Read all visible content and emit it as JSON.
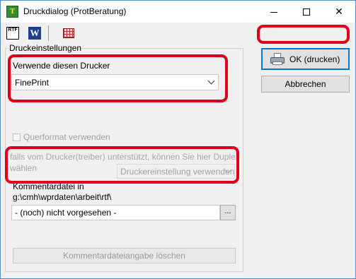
{
  "window": {
    "title": "Druckdialog (ProtBeratung)",
    "title_icon_glyph": "T",
    "close_glyph": "✕"
  },
  "toolbar": {
    "rtf_icon_text": "RTF",
    "word_icon_text": "W"
  },
  "group": {
    "legend": "Druckeinstellungen"
  },
  "printer": {
    "label": "Verwende diesen Drucker",
    "selected": "FinePrint"
  },
  "landscape": {
    "label": "Querformat verwenden",
    "checked": false,
    "enabled": false
  },
  "duplex": {
    "text": "falls vom Drucker(treiber) unterstützt, können Sie hier Duplex wählen",
    "selected": "Druckereinstellung verwenden",
    "enabled": false
  },
  "comment": {
    "label_line1": "Kommentardatei in",
    "label_line2": "g:\\cmh\\wprdaten\\arbeit\\rtf\\",
    "value": "- (noch) nicht vorgesehen -",
    "browse_label": "..."
  },
  "buttons": {
    "clear_label": "Kommentardateiangabe löschen",
    "ok_label": "OK (drucken)",
    "cancel_label": "Abbrechen"
  },
  "colors": {
    "highlight_border": "#e0001a",
    "default_button_border": "#0078d7"
  }
}
